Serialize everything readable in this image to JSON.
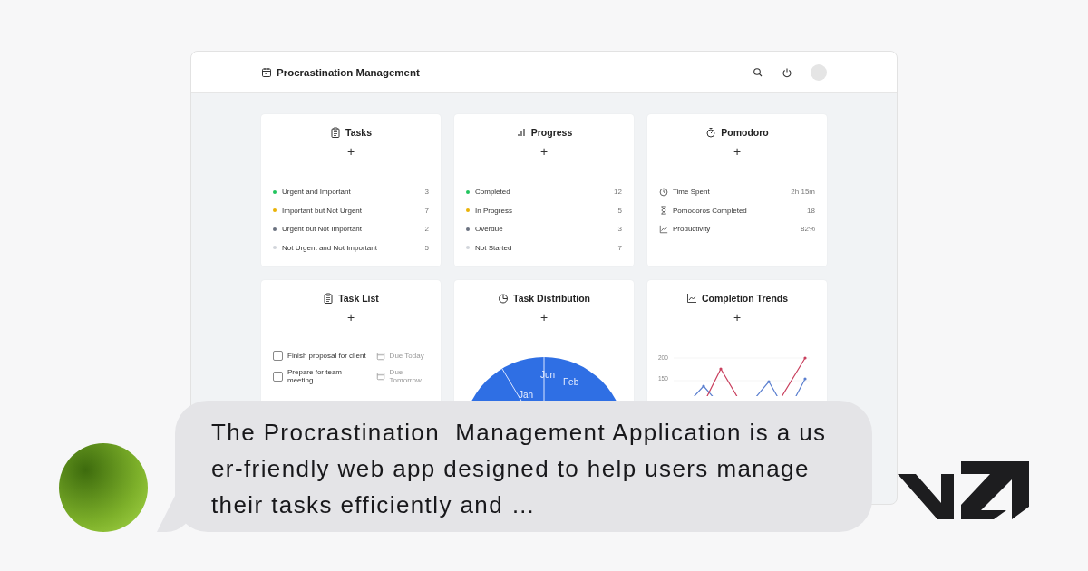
{
  "header": {
    "title": "Procrastination Management"
  },
  "tasks": {
    "title": "Tasks",
    "add": "+",
    "items": [
      {
        "label": "Urgent and Important",
        "count": "3",
        "color": "#22c55e"
      },
      {
        "label": "Important but Not Urgent",
        "count": "7",
        "color": "#eab308"
      },
      {
        "label": "Urgent but Not Important",
        "count": "2",
        "color": "#6b7280"
      },
      {
        "label": "Not Urgent and Not Important",
        "count": "5",
        "color": "#d1d5db"
      }
    ]
  },
  "progress": {
    "title": "Progress",
    "add": "+",
    "items": [
      {
        "label": "Completed",
        "count": "12",
        "color": "#22c55e"
      },
      {
        "label": "In Progress",
        "count": "5",
        "color": "#eab308"
      },
      {
        "label": "Overdue",
        "count": "3",
        "color": "#6b7280"
      },
      {
        "label": "Not Started",
        "count": "7",
        "color": "#d1d5db"
      }
    ]
  },
  "pomodoro": {
    "title": "Pomodoro",
    "add": "+",
    "items": [
      {
        "kind": "clock",
        "label": "Time Spent",
        "value": "2h 15m"
      },
      {
        "kind": "hourglass",
        "label": "Pomodoros Completed",
        "value": "18"
      },
      {
        "kind": "chart",
        "label": "Productivity",
        "value": "82%"
      }
    ]
  },
  "task_list": {
    "title": "Task List",
    "add": "+",
    "items": [
      {
        "label": "Finish proposal for client",
        "due": "Due Today",
        "checked": false
      },
      {
        "label": "Prepare for team meeting",
        "due": "Due Tomorrow",
        "checked": false
      }
    ]
  },
  "task_distribution": {
    "title": "Task Distribution",
    "add": "+",
    "slice_labels": [
      "Jun",
      "Feb",
      "Jan"
    ]
  },
  "completion_trends": {
    "title": "Completion Trends",
    "add": "+",
    "y_tick_labels": [
      "200",
      "150"
    ]
  },
  "message": {
    "lines": [
      "The Procrastination  Management Application is a us",
      "er-friendly web app designed to help users manage",
      "their tasks efficiently and …"
    ]
  }
}
